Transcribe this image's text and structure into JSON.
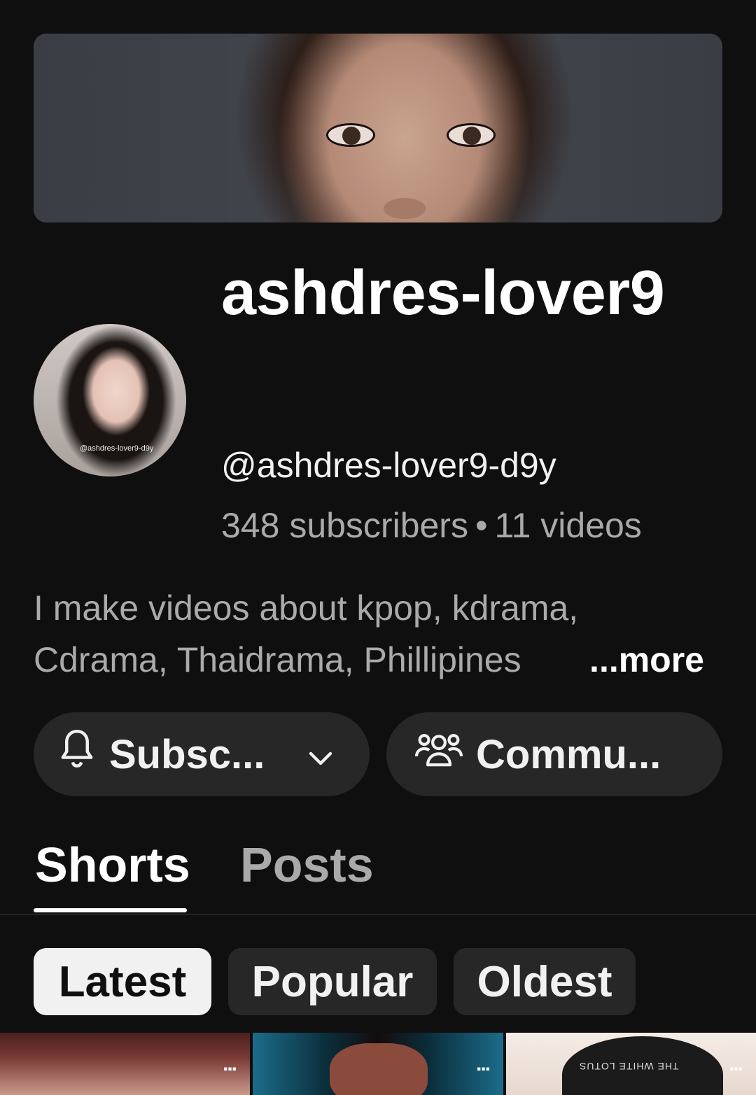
{
  "channel": {
    "name": "ashdres-lover9",
    "handle": "@ashdres-lover9-d9y",
    "subscribers": "348 subscribers",
    "separator": "•",
    "videos": "11 videos",
    "avatar_watermark": "@ashdres-lover9-d9y"
  },
  "description": {
    "line1": "I make videos about kpop, kdrama,",
    "line2": "Cdrama, Thaidrama, Phillipines",
    "more_label": "...more"
  },
  "actions": {
    "subscribe_label": "Subsc...",
    "community_label": "Commu..."
  },
  "tabs": [
    {
      "label": "Shorts",
      "selected": true
    },
    {
      "label": "Posts",
      "selected": false
    }
  ],
  "sort_chips": [
    {
      "label": "Latest",
      "selected": true
    },
    {
      "label": "Popular",
      "selected": false
    },
    {
      "label": "Oldest",
      "selected": false
    }
  ],
  "thumbnails": [
    {
      "menu": "..."
    },
    {
      "menu": "..."
    },
    {
      "menu": "...",
      "cap_text": "THE WHITE LOTUS"
    }
  ],
  "icons": {
    "subscribe": "bell-icon",
    "subscribe_dropdown": "chevron-down-icon",
    "community": "community-icon",
    "thumb_menu": "more-vert-icon"
  },
  "colors": {
    "background": "#0f0f0f",
    "surface": "#272727",
    "primary_text": "#f1f1f1",
    "secondary_text": "#aaaaaa"
  }
}
